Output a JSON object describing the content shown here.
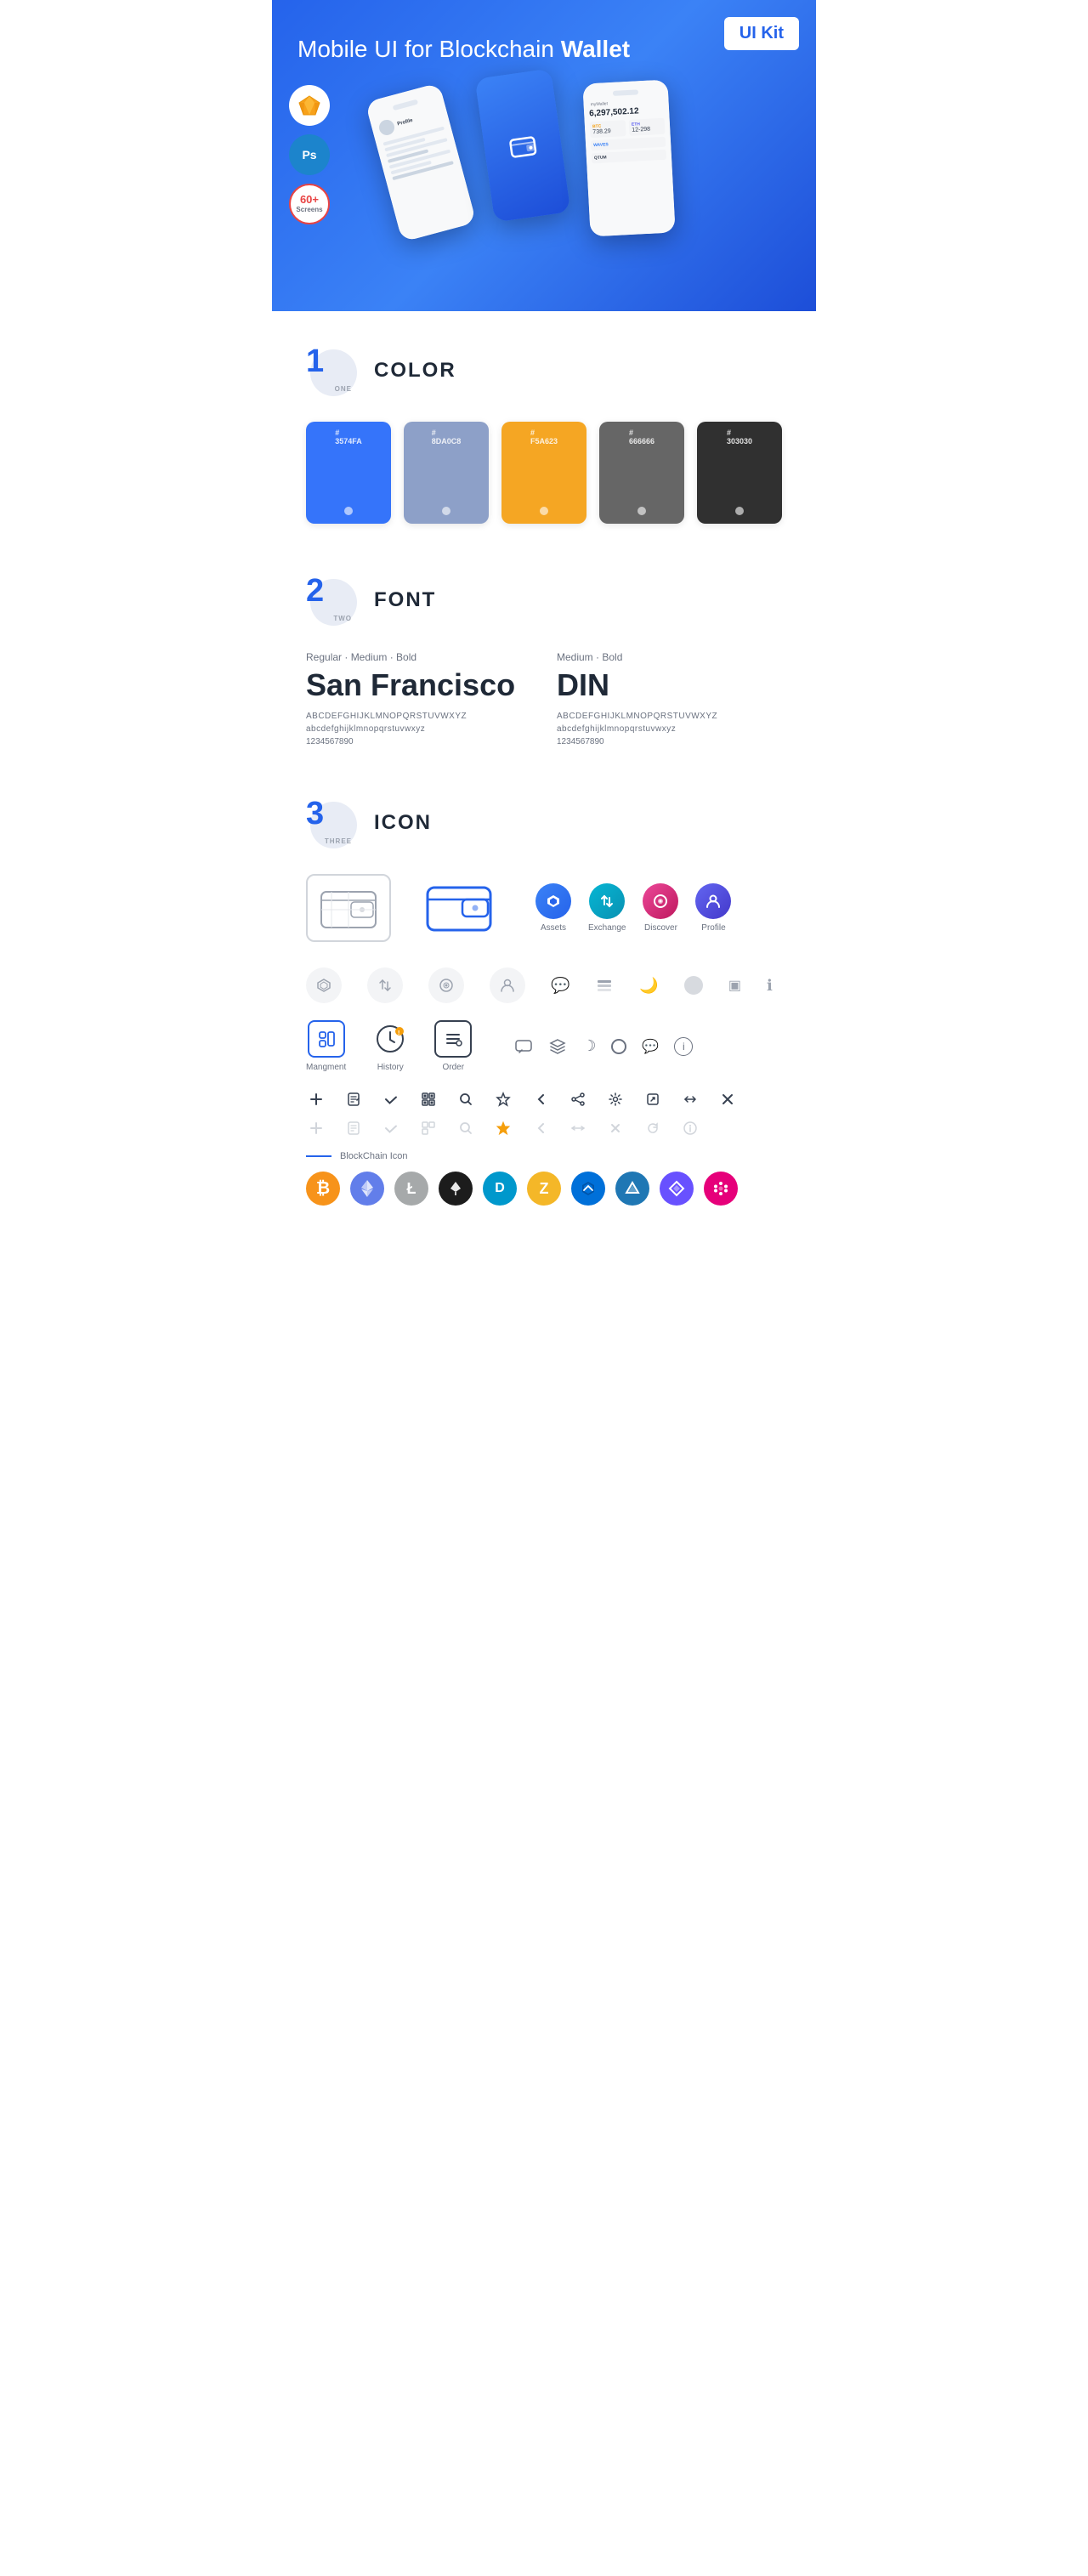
{
  "hero": {
    "title_normal": "Mobile UI for Blockchain ",
    "title_bold": "Wallet",
    "badge": "UI Kit",
    "badge_sketch": "S",
    "badge_ps": "Ps",
    "badge_screens": "60+\nScreens"
  },
  "sections": {
    "color": {
      "number": "1",
      "number_label": "ONE",
      "title": "COLOR",
      "swatches": [
        {
          "hex": "#3574FA",
          "code": "#\n3574FA",
          "label": "Blue"
        },
        {
          "hex": "#8DA0C8",
          "code": "#\n8DA0C8",
          "label": "Gray Blue"
        },
        {
          "hex": "#F5A623",
          "code": "#\nF5A623",
          "label": "Orange"
        },
        {
          "hex": "#666666",
          "code": "#\n666666",
          "label": "Gray"
        },
        {
          "hex": "#303030",
          "code": "#\n303030",
          "label": "Dark"
        }
      ]
    },
    "font": {
      "number": "2",
      "number_label": "TWO",
      "title": "FONT",
      "fonts": [
        {
          "style_label": "Regular · Medium · Bold",
          "name": "San Francisco",
          "uppercase": "ABCDEFGHIJKLMNOPQRSTUVWXYZ",
          "lowercase": "abcdefghijklmnopqrstuvwxyz",
          "numbers": "1234567890"
        },
        {
          "style_label": "Medium · Bold",
          "name": "DIN",
          "uppercase": "ABCDEFGHIJKLMNOPQRSTUVWXYZ",
          "lowercase": "abcdefghijklmnopqrstuvwxyz",
          "numbers": "1234567890"
        }
      ]
    },
    "icon": {
      "number": "3",
      "number_label": "THREE",
      "title": "ICON",
      "nav_icons": [
        {
          "label": "Assets"
        },
        {
          "label": "Exchange"
        },
        {
          "label": "Discover"
        },
        {
          "label": "Profile"
        }
      ],
      "tab_icons": [
        {
          "label": "Mangment"
        },
        {
          "label": "History"
        },
        {
          "label": "Order"
        }
      ],
      "blockchain_label": "BlockChain Icon",
      "crypto_icons": [
        {
          "symbol": "₿",
          "color": "#f7931a",
          "bg": "#fff3e0",
          "name": "bitcoin"
        },
        {
          "symbol": "Ξ",
          "color": "#627eea",
          "bg": "#ede9fe",
          "name": "ethereum"
        },
        {
          "symbol": "Ł",
          "color": "#a6a9aa",
          "bg": "#f3f4f6",
          "name": "litecoin"
        },
        {
          "symbol": "◆",
          "color": "#1a1a2e",
          "bg": "#e8e8f0",
          "name": "neo"
        },
        {
          "symbol": "D",
          "color": "#0098cc",
          "bg": "#e0f5ff",
          "name": "dash"
        },
        {
          "symbol": "Z",
          "color": "#f4b728",
          "bg": "#fef9e7",
          "name": "zcash"
        },
        {
          "symbol": "⬡",
          "color": "#3d9be9",
          "bg": "#e8f4fd",
          "name": "waves"
        },
        {
          "symbol": "▲",
          "color": "#2ab7b5",
          "bg": "#e0f5f4",
          "name": "stratis"
        },
        {
          "symbol": "◈",
          "color": "#6851ff",
          "bg": "#ede9fe",
          "name": "0x"
        },
        {
          "symbol": "∞",
          "color": "#e91e63",
          "bg": "#fce4ec",
          "name": "polkadot"
        }
      ]
    }
  }
}
